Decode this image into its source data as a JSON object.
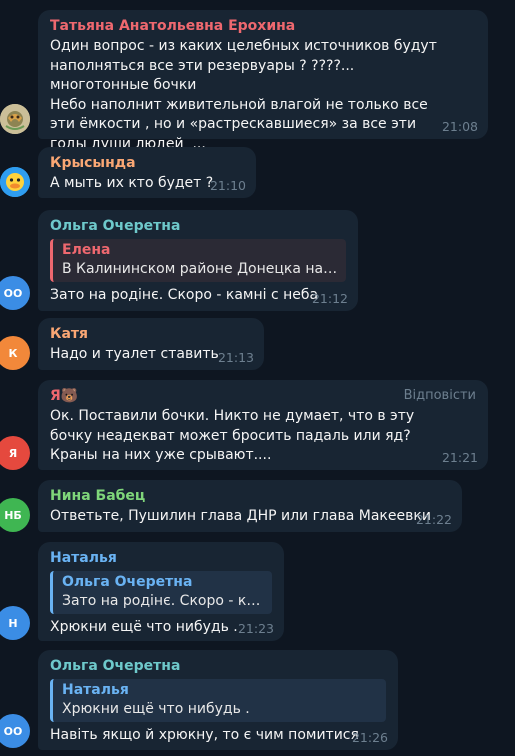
{
  "messages": [
    {
      "sender": "Татьяна Анатольевна Ерохина",
      "sender_color": "#ee686f",
      "text": "Один вопрос - из каких целебных источников будут наполняться все эти резервуары ? ????... многотонные бочки\nНебо наполнит живительной влагой не только все эти ёмкости , но и «растрескавшиеся» за все эти годы души людей  ...",
      "time": "21:08",
      "avatar_type": "photo"
    },
    {
      "sender": "Крысында",
      "sender_color": "#faa774",
      "text": "А мыть их кто будет ?",
      "time": "21:10",
      "avatar_type": "duck"
    },
    {
      "sender": "Ольга Очеретна",
      "sender_color": "#6ec9cb",
      "reply": {
        "name": "Елена",
        "text": "В Калининском районе Донецка на ул...",
        "color": "#ee686f"
      },
      "text": "Зато на родінє. Скоро - камні с неба",
      "time": "21:12",
      "avatar_initials": "ОО",
      "avatar_color": "#3b8de5"
    },
    {
      "sender": "Катя",
      "sender_color": "#faa774",
      "text": "Надо и туалет ставить",
      "time": "21:13",
      "avatar_initials": "К",
      "avatar_color": "#f2883a"
    },
    {
      "sender": "Я🐻",
      "sender_color": "#ee686f",
      "reply_action": "Відповісти",
      "text": "Ок. Поставили бочки. Никто не думает, что в эту бочку неадекват может бросить падаль или яд? Краны на них уже срывают....",
      "time": "21:21",
      "avatar_initials": "Я",
      "avatar_color": "#e5493e"
    },
    {
      "sender": "Нина Бабец",
      "sender_color": "#7fd67a",
      "text": "Ответьте, Пушилин глава ДНР или глава Макеевки",
      "time": "21:22",
      "avatar_initials": "НБ",
      "avatar_color": "#3fb652"
    },
    {
      "sender": "Наталья",
      "sender_color": "#6ab3f3",
      "reply": {
        "name": "Ольга Очеретна",
        "text": "Зато на родінє. Скоро - кам...",
        "color": "#6ab3f3"
      },
      "text": "Хрюкни ещё что нибудь .",
      "time": "21:23",
      "avatar_initials": "Н",
      "avatar_color": "#3b8de5"
    },
    {
      "sender": "Ольга Очеретна",
      "sender_color": "#6ec9cb",
      "reply": {
        "name": "Наталья",
        "text": "Хрюкни ещё что нибудь .",
        "color": "#6ab3f3"
      },
      "text": "Навіть якщо й хрюкну, то є чим помитися",
      "time": "21:26",
      "avatar_initials": "ОО",
      "avatar_color": "#3b8de5"
    }
  ]
}
